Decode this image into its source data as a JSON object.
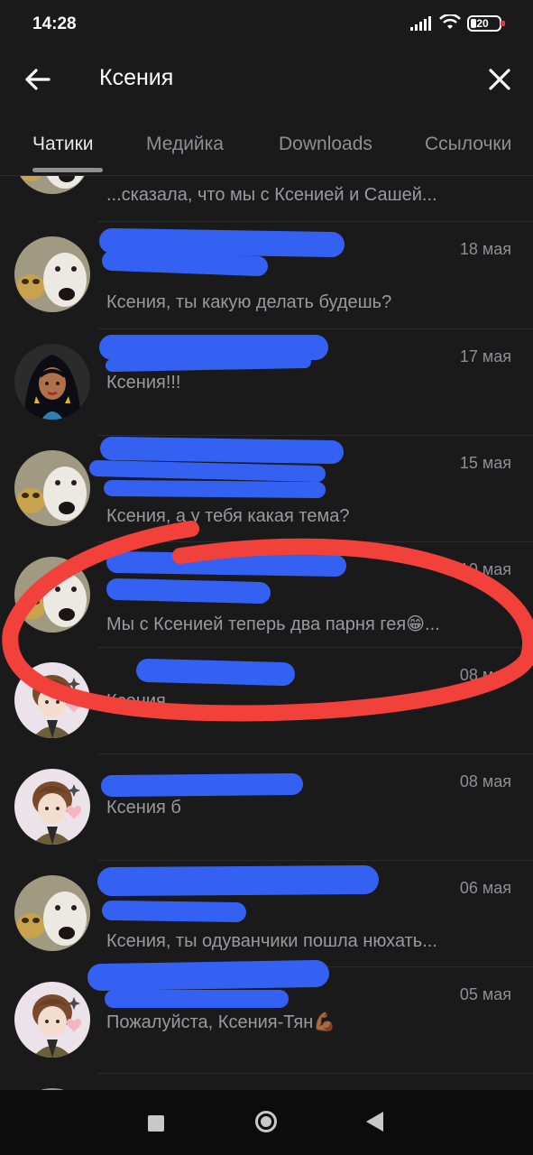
{
  "status_bar": {
    "time": "14:28",
    "battery": "20",
    "icons": [
      "signal-icon",
      "wifi-icon",
      "battery-icon"
    ]
  },
  "header": {
    "back_icon": "arrow-left-icon",
    "search_value": "Ксения",
    "close_icon": "close-icon"
  },
  "tabs": [
    {
      "label": "Чатики",
      "active": true
    },
    {
      "label": "Медийка",
      "active": false
    },
    {
      "label": "Downloads",
      "active": false
    },
    {
      "label": "Ссылочки",
      "active": false
    }
  ],
  "chats": [
    {
      "date": "",
      "line1": "",
      "line2": "...сказала, что мы с Ксенией и Сашей..."
    },
    {
      "date": "18 мая",
      "line1": "",
      "line2": "Ксения, ты какую делать будешь?"
    },
    {
      "date": "17 мая",
      "line1": "Ксения!!!",
      "line2": ""
    },
    {
      "date": "15 мая",
      "line1": "",
      "line2": "Ксения, а у тебя какая тема?"
    },
    {
      "date": "10 мая",
      "line1": "",
      "line2": "Мы с Ксенией теперь два парня гея😁..."
    },
    {
      "date": "08 мая",
      "line1": "Ксения",
      "line2": ""
    },
    {
      "date": "08 мая",
      "line1": "Ксения б",
      "line2": ""
    },
    {
      "date": "06 мая",
      "line1": "",
      "line2": "Ксения, ты одуванчики пошла нюхать..."
    },
    {
      "date": "05 мая",
      "line1": "Пожалуйста, Ксения-Тян💪🏾",
      "line2": ""
    }
  ],
  "colors": {
    "background": "#1a1a1b",
    "redact_blue": "#3461f2",
    "annotation_red": "#f2413b"
  },
  "nav_bar": {
    "icons": [
      "recents-square-icon",
      "home-circle-icon",
      "back-triangle-icon"
    ]
  }
}
